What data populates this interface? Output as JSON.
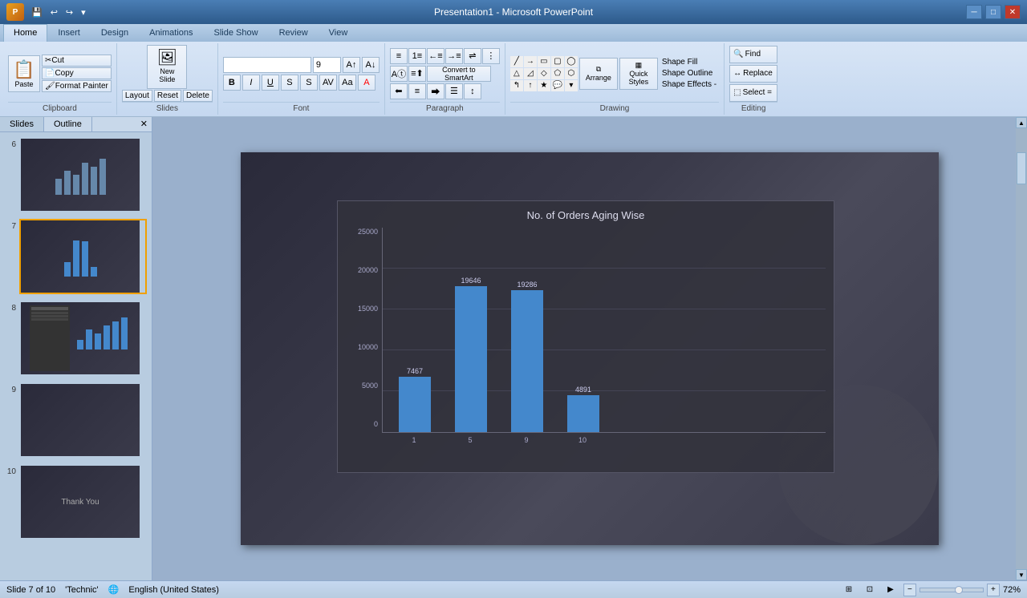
{
  "titlebar": {
    "title": "Presentation1 - Microsoft PowerPoint",
    "min_btn": "─",
    "max_btn": "□",
    "close_btn": "✕",
    "app_name": "P"
  },
  "ribbon": {
    "tabs": [
      "Home",
      "Insert",
      "Design",
      "Animations",
      "Slide Show",
      "Review",
      "View"
    ],
    "active_tab": "Home",
    "groups": {
      "clipboard": {
        "label": "Clipboard",
        "cut": "Cut",
        "copy": "Copy",
        "paste": "Paste",
        "format_painter": "Format Painter"
      },
      "slides": {
        "label": "Slides",
        "new_slide": "New Slide",
        "layout": "Layout",
        "reset": "Reset",
        "delete": "Delete"
      },
      "font": {
        "label": "Font",
        "font_name": "",
        "font_size": "9",
        "bold": "B",
        "italic": "I",
        "underline": "U",
        "strikethrough": "S"
      },
      "paragraph": {
        "label": "Paragraph"
      },
      "drawing": {
        "label": "Drawing"
      },
      "arrange": "Arrange",
      "quick_styles": "Quick Styles",
      "shape_fill": "Shape Fill",
      "shape_outline": "Shape Outline",
      "shape_effects": "Shape Effects -",
      "find": "Find",
      "replace": "Replace",
      "select": "Select =",
      "editing": {
        "label": "Editing"
      }
    }
  },
  "slides_panel": {
    "tabs": [
      "Slides",
      "Outline"
    ],
    "active_tab": "Slides",
    "slides": [
      {
        "num": "6",
        "active": false
      },
      {
        "num": "7",
        "active": true
      },
      {
        "num": "8",
        "active": false
      },
      {
        "num": "9",
        "active": false
      },
      {
        "num": "10",
        "active": false
      }
    ]
  },
  "chart": {
    "title": "No. of Orders Aging Wise",
    "y_labels": [
      "25000",
      "20000",
      "15000",
      "10000",
      "5000",
      "0"
    ],
    "bars": [
      {
        "x_label": "1",
        "value": 7467,
        "height_pct": 30
      },
      {
        "x_label": "5",
        "value": 19646,
        "height_pct": 79
      },
      {
        "x_label": "9",
        "value": 19286,
        "height_pct": 77
      },
      {
        "x_label": "10",
        "value": 4891,
        "height_pct": 20
      }
    ]
  },
  "status_bar": {
    "slide_info": "Slide 7 of 10",
    "theme": "'Technic'",
    "language": "English (United States)",
    "zoom": "72%"
  }
}
